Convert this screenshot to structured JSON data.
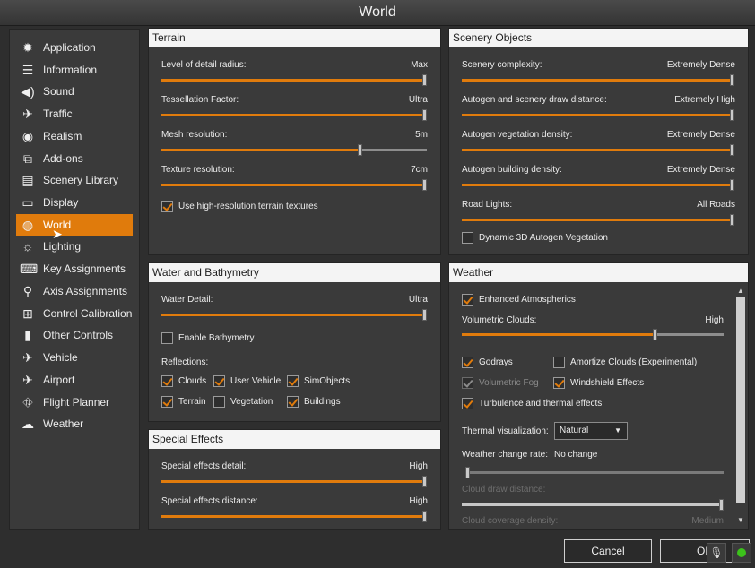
{
  "window": {
    "title": "World"
  },
  "sidebar": {
    "items": [
      {
        "label": "Application",
        "icon": "gear-icon"
      },
      {
        "label": "Information",
        "icon": "list-icon"
      },
      {
        "label": "Sound",
        "icon": "speaker-icon"
      },
      {
        "label": "Traffic",
        "icon": "traffic-plane-icon"
      },
      {
        "label": "Realism",
        "icon": "realism-icon"
      },
      {
        "label": "Add-ons",
        "icon": "addons-icon"
      },
      {
        "label": "Scenery Library",
        "icon": "library-icon"
      },
      {
        "label": "Display",
        "icon": "monitor-icon"
      },
      {
        "label": "World",
        "icon": "globe-icon",
        "active": true
      },
      {
        "label": "Lighting",
        "icon": "lighting-icon"
      },
      {
        "label": "Key Assignments",
        "icon": "keyboard-icon"
      },
      {
        "label": "Axis Assignments",
        "icon": "joystick-icon"
      },
      {
        "label": "Control Calibration",
        "icon": "calibration-icon"
      },
      {
        "label": "Other Controls",
        "icon": "controller-icon"
      },
      {
        "label": "Vehicle",
        "icon": "plane-icon"
      },
      {
        "label": "Airport",
        "icon": "airport-icon"
      },
      {
        "label": "Flight Planner",
        "icon": "route-icon"
      },
      {
        "label": "Weather",
        "icon": "cloud-icon"
      }
    ]
  },
  "terrain": {
    "title": "Terrain",
    "lod_label": "Level of detail radius:",
    "lod_value": "Max",
    "lod_level": 1.0,
    "tess_label": "Tessellation Factor:",
    "tess_value": "Ultra",
    "tess_level": 1.0,
    "mesh_label": "Mesh resolution:",
    "mesh_value": "5m",
    "mesh_level": 0.75,
    "tex_label": "Texture resolution:",
    "tex_value": "7cm",
    "tex_level": 1.0,
    "hires_label": "Use high-resolution terrain textures",
    "hires_checked": true
  },
  "water": {
    "title": "Water and Bathymetry",
    "detail_label": "Water Detail:",
    "detail_value": "Ultra",
    "detail_level": 1.0,
    "bathymetry_label": "Enable Bathymetry",
    "bathymetry_checked": false,
    "reflections_label": "Reflections:",
    "clouds_label": "Clouds",
    "clouds_checked": true,
    "user_vehicle_label": "User Vehicle",
    "user_vehicle_checked": true,
    "simobjects_label": "SimObjects",
    "simobjects_checked": true,
    "terrain_label": "Terrain",
    "terrain_checked": true,
    "vegetation_label": "Vegetation",
    "vegetation_checked": false,
    "buildings_label": "Buildings",
    "buildings_checked": true
  },
  "effects": {
    "title": "Special Effects",
    "detail_label": "Special effects detail:",
    "detail_value": "High",
    "detail_level": 1.0,
    "distance_label": "Special effects distance:",
    "distance_value": "High",
    "distance_level": 1.0
  },
  "scenery": {
    "title": "Scenery Objects",
    "complexity_label": "Scenery complexity:",
    "complexity_value": "Extremely Dense",
    "complexity_level": 1.0,
    "autogen_dist_label": "Autogen and scenery draw distance:",
    "autogen_dist_value": "Extremely High",
    "autogen_dist_level": 1.0,
    "veg_density_label": "Autogen vegetation density:",
    "veg_density_value": "Extremely Dense",
    "veg_density_level": 1.0,
    "bld_density_label": "Autogen building density:",
    "bld_density_value": "Extremely Dense",
    "bld_density_level": 1.0,
    "road_label": "Road Lights:",
    "road_value": "All Roads",
    "road_level": 1.0,
    "dyn_veg_label": "Dynamic 3D Autogen Vegetation",
    "dyn_veg_checked": false
  },
  "weather": {
    "title": "Weather",
    "enhanced_label": "Enhanced Atmospherics",
    "enhanced_checked": true,
    "vol_clouds_label": "Volumetric Clouds:",
    "vol_clouds_value": "High",
    "vol_clouds_level": 0.74,
    "godrays_label": "Godrays",
    "godrays_checked": true,
    "amortize_label": "Amortize Clouds (Experimental)",
    "amortize_checked": false,
    "vol_fog_label": "Volumetric Fog",
    "vol_fog_checked": true,
    "windshield_label": "Windshield Effects",
    "windshield_checked": true,
    "turbulence_label": "Turbulence and thermal effects",
    "turbulence_checked": true,
    "thermal_label": "Thermal visualization:",
    "thermal_value": "Natural",
    "change_rate_label": "Weather change rate:",
    "change_rate_value": "No change",
    "change_rate_level": 0.0,
    "cloud_draw_label": "Cloud draw distance:",
    "cloud_draw_level": 1.0,
    "cloud_coverage_label": "Cloud coverage density:",
    "cloud_coverage_value": "Medium"
  },
  "buttons": {
    "cancel": "Cancel",
    "ok": "OK"
  },
  "colors": {
    "accent": "#e07b0c",
    "panel": "#3a3a3a",
    "background": "#2e2e2e",
    "status_led": "#3cc21b"
  }
}
